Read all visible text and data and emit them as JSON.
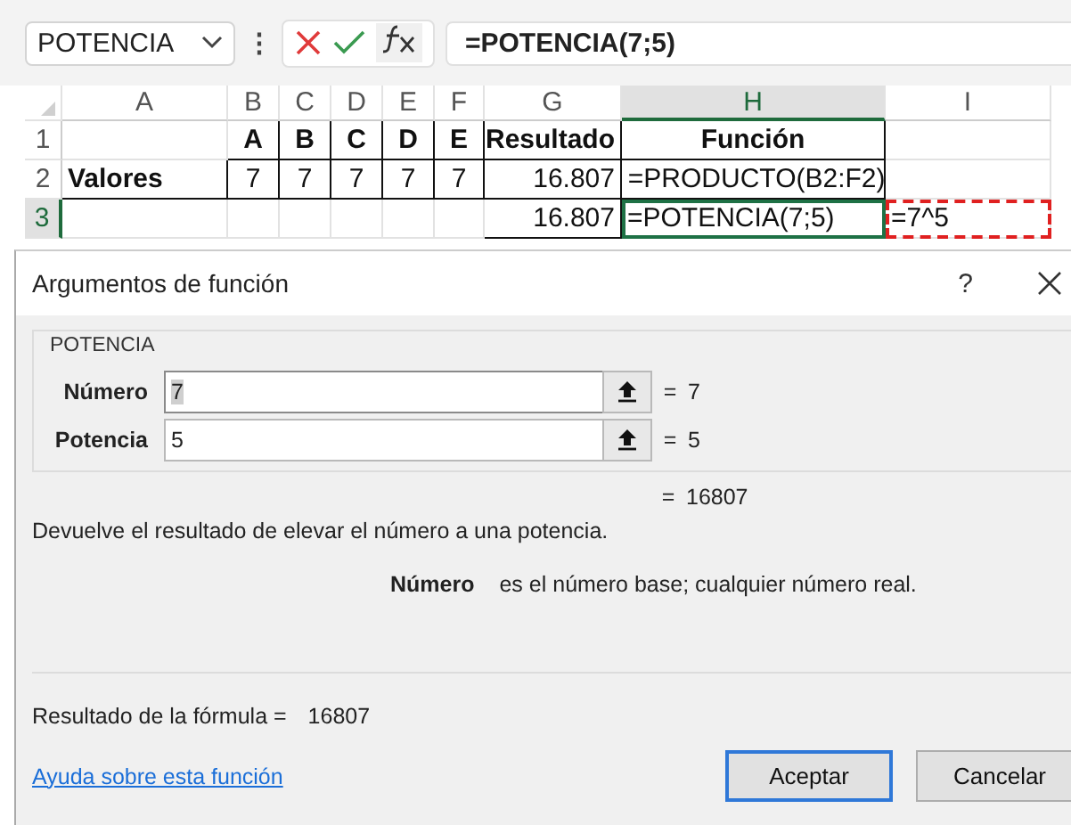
{
  "name_box": {
    "value": "POTENCIA"
  },
  "formula_bar": {
    "more": "⋮",
    "value": "=POTENCIA(7;5)"
  },
  "sheet": {
    "columns": [
      {
        "label": "A",
        "selected": false
      },
      {
        "label": "B",
        "selected": false
      },
      {
        "label": "C",
        "selected": false
      },
      {
        "label": "D",
        "selected": false
      },
      {
        "label": "E",
        "selected": false
      },
      {
        "label": "F",
        "selected": false
      },
      {
        "label": "G",
        "selected": false
      },
      {
        "label": "H",
        "selected": true
      },
      {
        "label": "I",
        "selected": false
      }
    ],
    "rows": [
      {
        "label": "1",
        "selected": false,
        "cells": [
          {
            "text": ""
          },
          {
            "text": "A",
            "bold": true
          },
          {
            "text": "B",
            "bold": true
          },
          {
            "text": "C",
            "bold": true
          },
          {
            "text": "D",
            "bold": true
          },
          {
            "text": "E",
            "bold": true
          },
          {
            "text": "Resultado",
            "bold": true
          },
          {
            "text": "Función",
            "bold": true
          },
          {
            "text": ""
          }
        ]
      },
      {
        "label": "2",
        "selected": false,
        "cells": [
          {
            "text": "Valores",
            "bold": true
          },
          {
            "text": "7",
            "bold": false
          },
          {
            "text": "7",
            "bold": false
          },
          {
            "text": "7",
            "bold": false
          },
          {
            "text": "7",
            "bold": false
          },
          {
            "text": "7",
            "bold": false
          },
          {
            "text": "16.807",
            "bold": false
          },
          {
            "text": " =PRODUCTO(B2:F2)",
            "bold": false
          },
          {
            "text": ""
          }
        ]
      },
      {
        "label": "3",
        "selected": true,
        "cells": [
          {
            "text": ""
          },
          {
            "text": ""
          },
          {
            "text": ""
          },
          {
            "text": ""
          },
          {
            "text": ""
          },
          {
            "text": ""
          },
          {
            "text": "16.807",
            "bold": false
          },
          {
            "text": "=POTENCIA(7;5)",
            "bold": false,
            "selected": true
          },
          {
            "text": "=7^5",
            "bold": false,
            "marquee": true
          }
        ]
      }
    ]
  },
  "dialog": {
    "title": "Argumentos de función",
    "help": "?",
    "group": "POTENCIA",
    "arguments": [
      {
        "label": "Número",
        "value": "7",
        "focused": true,
        "equals": "=",
        "result": "7"
      },
      {
        "label": "Potencia",
        "value": "5",
        "focused": false,
        "equals": "=",
        "result": "5"
      }
    ],
    "result": {
      "equals": "=",
      "value": "16807"
    },
    "description": "Devuelve el resultado de elevar el número a una potencia.",
    "argument_help": {
      "name": "Número",
      "text": "es el número base; cualquier número real."
    },
    "formula_result": {
      "label": "Resultado de la fórmula =",
      "value": "16807"
    },
    "help_link": "Ayuda sobre esta función",
    "buttons": [
      {
        "label": "Aceptar",
        "default": true
      },
      {
        "label": "Cancelar",
        "default": false
      }
    ]
  }
}
